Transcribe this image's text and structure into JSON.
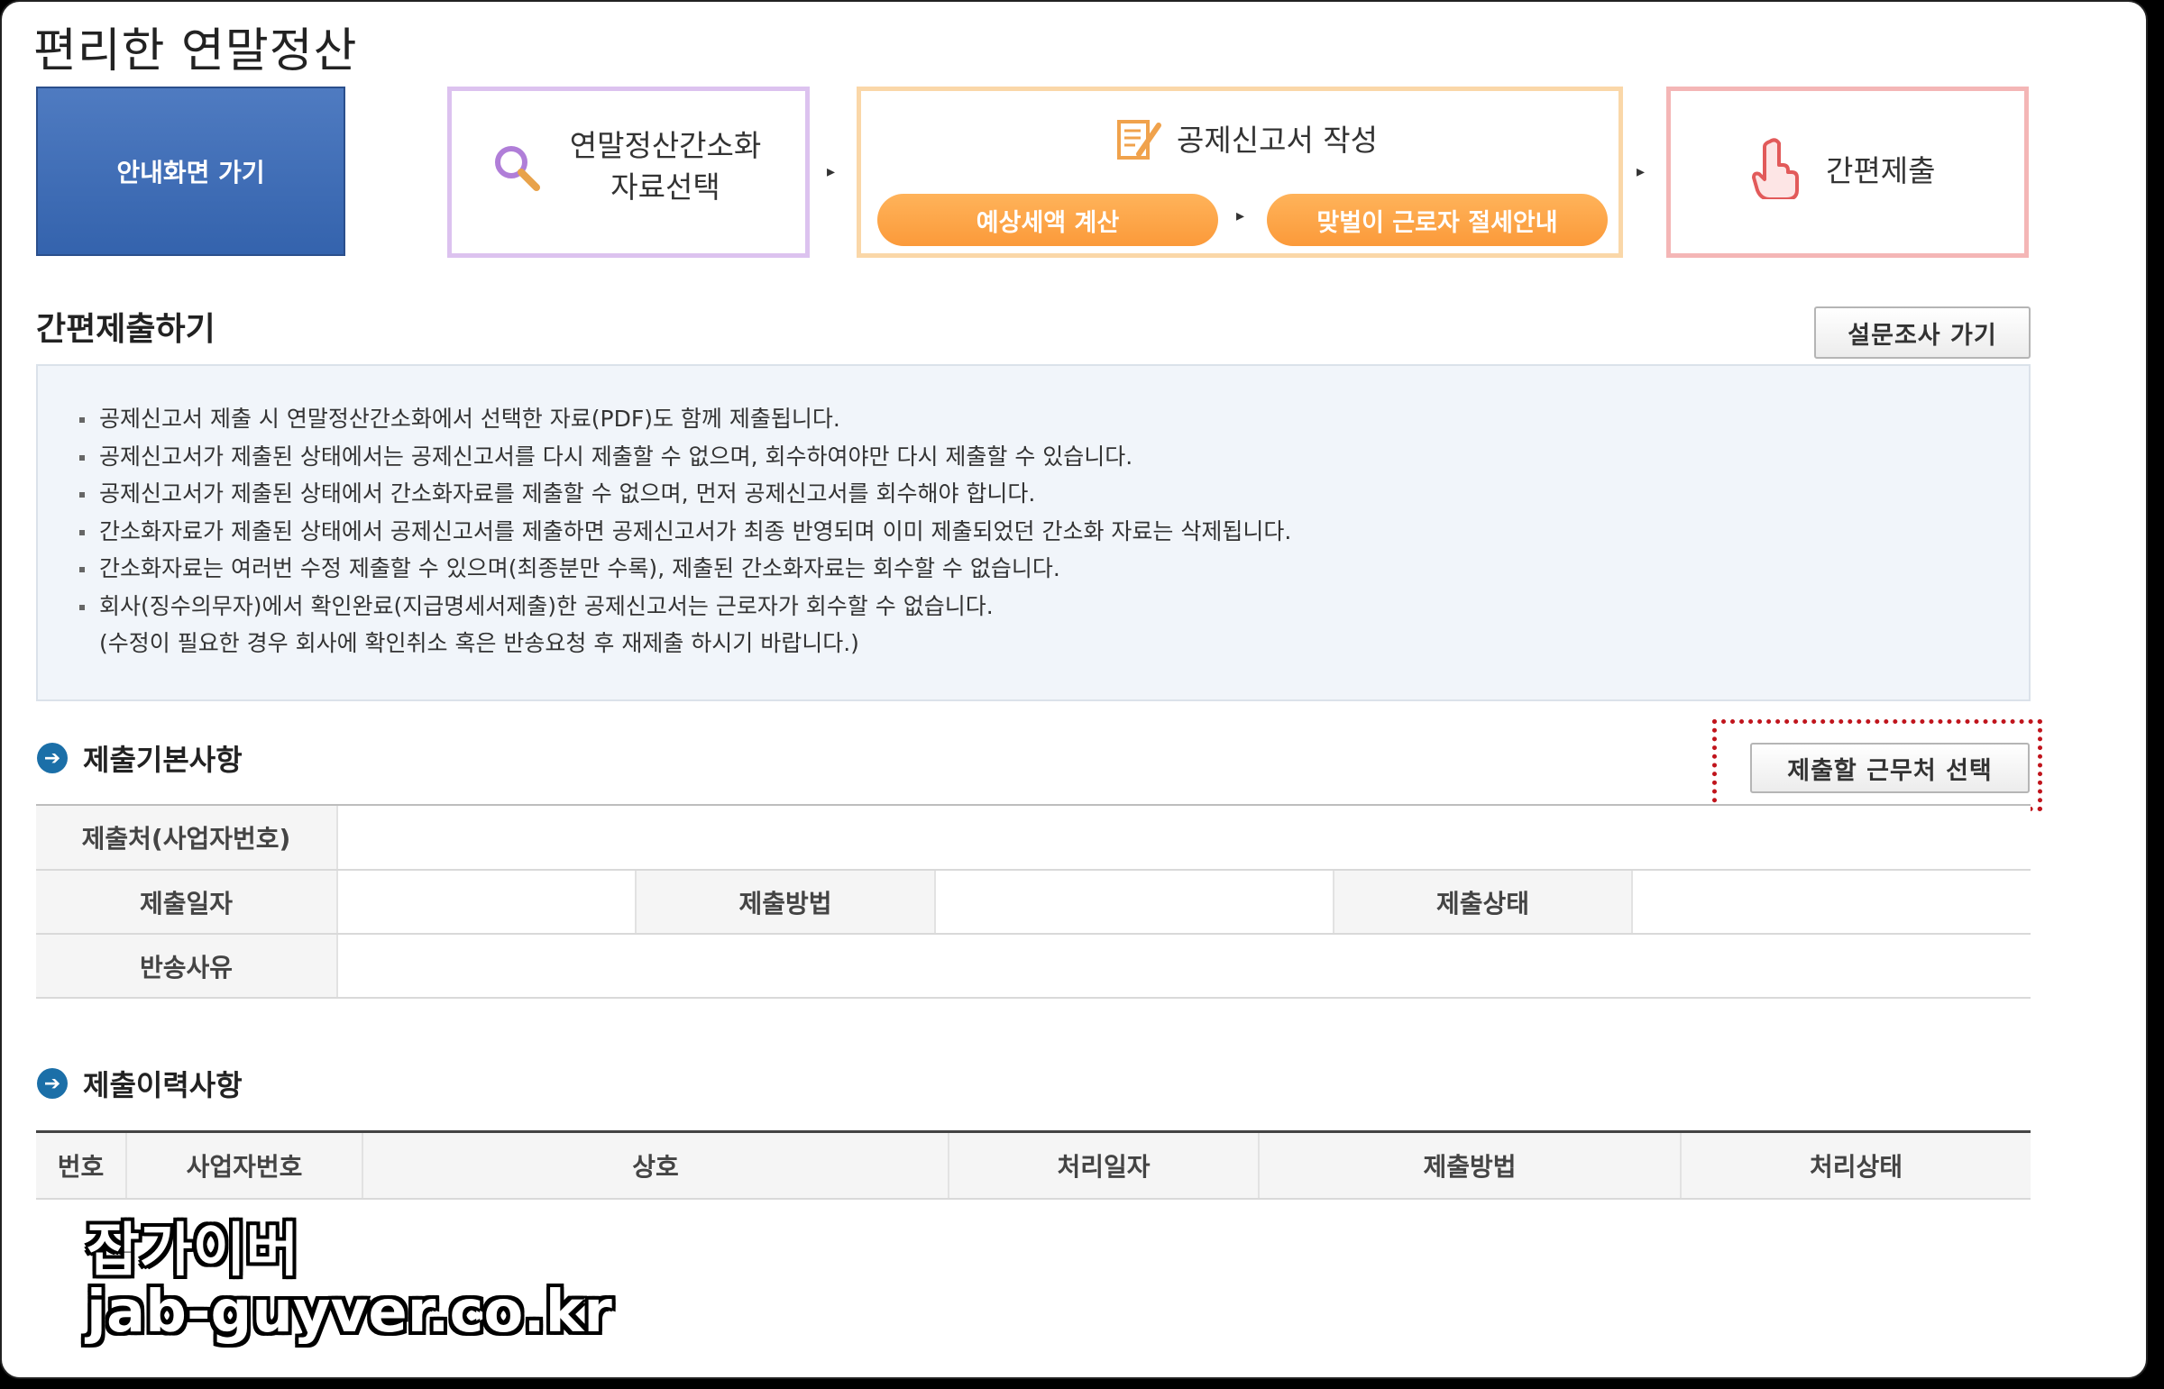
{
  "page_title": "편리한 연말정산",
  "steps": {
    "guide_button": "안내화면 가기",
    "step1_line1": "연말정산간소화",
    "step1_line2": "자료선택",
    "step2_title": "공제신고서 작성",
    "step2_pill1": "예상세액 계산",
    "step2_pill2": "맞벌이 근로자 절세안내",
    "step3_title": "간편제출",
    "arrow": "▸"
  },
  "section": {
    "title": "간편제출하기",
    "survey_button": "설문조사 가기"
  },
  "notice": {
    "items": [
      "공제신고서 제출 시 연말정산간소화에서 선택한 자료(PDF)도 함께 제출됩니다.",
      "공제신고서가 제출된 상태에서는 공제신고서를 다시 제출할 수 없으며, 회수하여야만 다시 제출할 수 있습니다.",
      "공제신고서가 제출된 상태에서 간소화자료를 제출할 수 없으며, 먼저 공제신고서를 회수해야 합니다.",
      "간소화자료가 제출된 상태에서 공제신고서를 제출하면 공제신고서가 최종 반영되며 이미 제출되었던 간소화 자료는 삭제됩니다.",
      "간소화자료는 여러번 수정 제출할 수 있으며(최종분만 수록), 제출된 간소화자료는 회수할 수 없습니다.",
      "회사(징수의무자)에서 확인완료(지급명세서제출)한 공제신고서는 근로자가 회수할 수 없습니다."
    ],
    "continuation": "(수정이 필요한 경우 회사에 확인취소 혹은 반송요청 후 재제출 하시기 바랍니다.)"
  },
  "basic_info": {
    "title": "제출기본사항",
    "select_button": "제출할 근무처 선택",
    "labels": {
      "submitter": "제출처(사업자번호)",
      "date": "제출일자",
      "method": "제출방법",
      "status": "제출상태",
      "return_reason": "반송사유"
    }
  },
  "history": {
    "title": "제출이력사항",
    "columns": [
      "번호",
      "사업자번호",
      "상호",
      "처리일자",
      "제출방법",
      "처리상태"
    ]
  },
  "watermark": {
    "line1": "잡가이버",
    "line2": "jab-guyver.co.kr"
  },
  "colors": {
    "guide_blue": "#3f6db7",
    "pill_orange": "#fb9a3a",
    "step1_border": "#dcc2ef",
    "step2_border": "#fad7a8",
    "step3_border": "#f4b6b6",
    "highlight_red": "#c0141c"
  }
}
